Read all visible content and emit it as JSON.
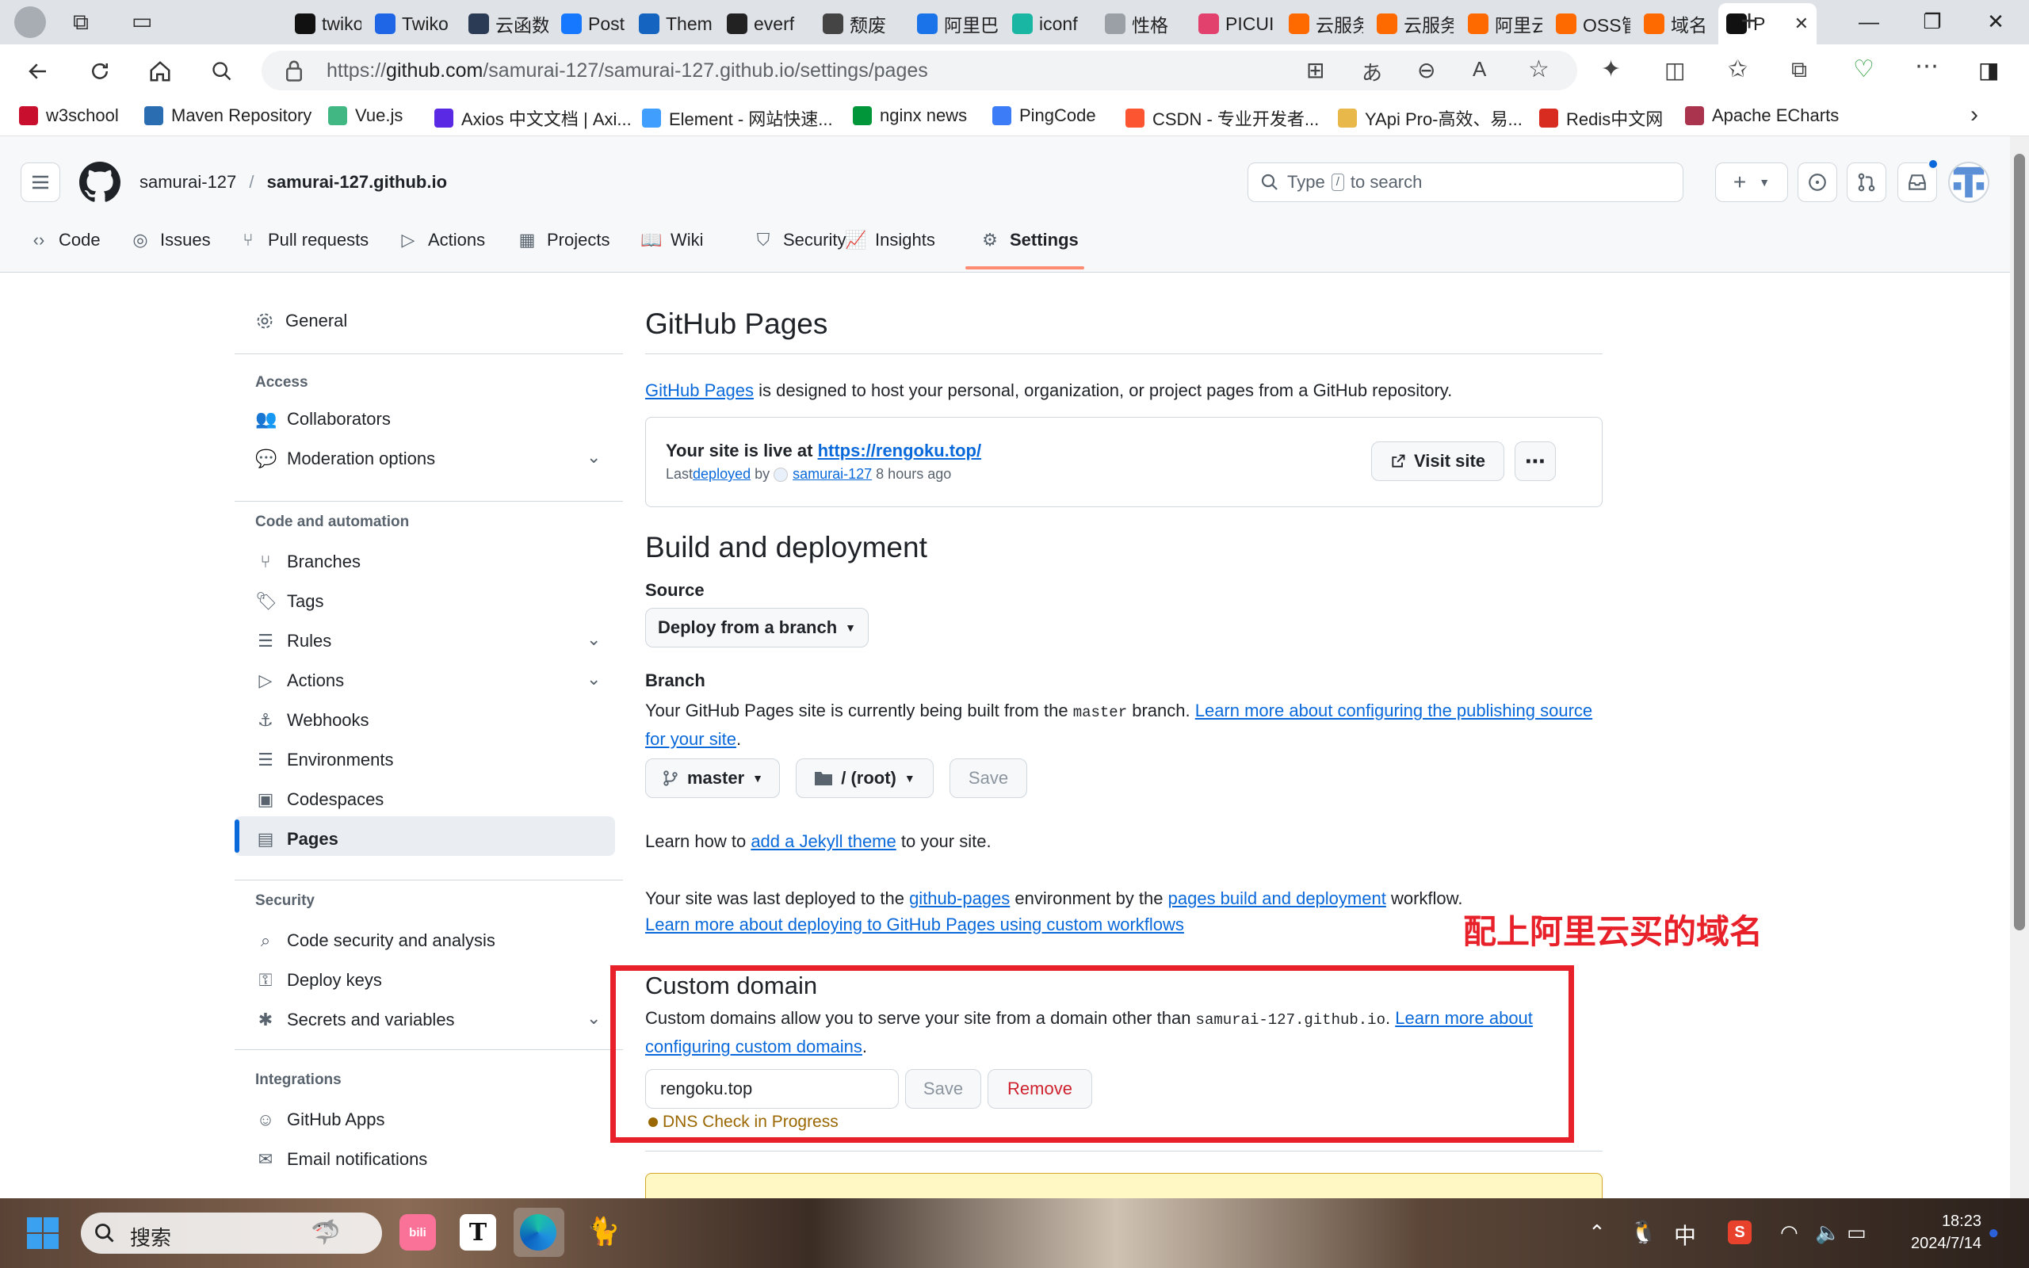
{
  "browser": {
    "tabs": [
      {
        "label": "twiko",
        "color": "#111111"
      },
      {
        "label": "Twiko",
        "color": "#1e66e6"
      },
      {
        "label": "云函数",
        "color": "#2b3a55"
      },
      {
        "label": "PostC",
        "color": "#1677ff"
      },
      {
        "label": "Them",
        "color": "#1565c0"
      },
      {
        "label": "everf",
        "color": "#222222"
      },
      {
        "label": "颓废",
        "color": "#444444"
      },
      {
        "label": "阿里巴",
        "color": "#1a73e8"
      },
      {
        "label": "iconf",
        "color": "#19b7a3"
      },
      {
        "label": "性格",
        "color": "#9aa0a6"
      },
      {
        "label": "PICUI",
        "color": "#e2416e"
      },
      {
        "label": "云服务",
        "color": "#ff6a00"
      },
      {
        "label": "云服务",
        "color": "#ff6a00"
      },
      {
        "label": "阿里云",
        "color": "#ff6a00"
      },
      {
        "label": "OSS管",
        "color": "#ff6a00"
      },
      {
        "label": "域名",
        "color": "#ff6a00"
      },
      {
        "label": "P",
        "color": "#111111"
      }
    ],
    "url_prefix": "https://",
    "url_host": "github.com",
    "url_path": "/samurai-127/samurai-127.github.io/settings/pages",
    "bookmarks": [
      {
        "label": "w3school",
        "color": "#c8102e"
      },
      {
        "label": "Maven Repository",
        "color": "#2a6db0"
      },
      {
        "label": "Vue.js",
        "color": "#41b883"
      },
      {
        "label": "Axios 中文文档 | Axi...",
        "color": "#5a29e4"
      },
      {
        "label": "Element - 网站快速...",
        "color": "#409eff"
      },
      {
        "label": "nginx news",
        "color": "#009639"
      },
      {
        "label": "PingCode",
        "color": "#3c7cf7"
      },
      {
        "label": "CSDN - 专业开发者...",
        "color": "#fc5531"
      },
      {
        "label": "YApi Pro-高效、易...",
        "color": "#e8b84a"
      },
      {
        "label": "Redis中文网",
        "color": "#d82c20"
      },
      {
        "label": "Apache ECharts",
        "color": "#aa344d"
      }
    ]
  },
  "github": {
    "owner": "samurai-127",
    "repo": "samurai-127.github.io",
    "search_placeholder_pre": "Type",
    "search_key": "/",
    "search_placeholder_post": "to search",
    "repo_tabs": [
      "Code",
      "Issues",
      "Pull requests",
      "Actions",
      "Projects",
      "Wiki",
      "Security",
      "Insights",
      "Settings"
    ],
    "active_tab": "Settings"
  },
  "sidebar": {
    "general": "General",
    "access_heading": "Access",
    "access": [
      "Collaborators",
      "Moderation options"
    ],
    "code_heading": "Code and automation",
    "code": [
      "Branches",
      "Tags",
      "Rules",
      "Actions",
      "Webhooks",
      "Environments",
      "Codespaces",
      "Pages"
    ],
    "security_heading": "Security",
    "security": [
      "Code security and analysis",
      "Deploy keys",
      "Secrets and variables"
    ],
    "integrations_heading": "Integrations",
    "integrations": [
      "GitHub Apps",
      "Email notifications"
    ]
  },
  "pages": {
    "title": "GitHub Pages",
    "intro_link": "GitHub Pages",
    "intro_rest": " is designed to host your personal, organization, or project pages from a GitHub repository.",
    "live_prefix": "Your site is live at ",
    "live_url": "https://rengoku.top/",
    "last_prefix": "Last ",
    "last_link": "deployed",
    "last_by": " by ",
    "last_user": "samurai-127",
    "last_time": " 8 hours ago",
    "visit_site": "Visit site",
    "build_title": "Build and deployment",
    "source_label": "Source",
    "source_value": "Deploy from a branch",
    "branch_label": "Branch",
    "branch_text_1": "Your GitHub Pages site is currently being built from the ",
    "branch_code": "master",
    "branch_text_2": " branch. ",
    "branch_link_1": "Learn more about configuring the publishing source",
    "branch_link_2": "for your site",
    "branch_text_3": ".",
    "branch_value": "master",
    "folder_value": "/ (root)",
    "save": "Save",
    "jekyll_pre": "Learn how to ",
    "jekyll_link": "add a Jekyll theme",
    "jekyll_post": " to your site.",
    "deployed_1": "Your site was last deployed to the ",
    "deployed_env": "github-pages",
    "deployed_2": " environment by the ",
    "deployed_wf": "pages build and deployment",
    "deployed_3": " workflow.",
    "deployed_link": "Learn more about deploying to GitHub Pages using custom workflows",
    "custom_title": "Custom domain",
    "custom_text_1": "Custom domains allow you to serve your site from a domain other than ",
    "custom_code": "samurai-127.github.io",
    "custom_text_2": ". ",
    "custom_link_1": "Learn more about",
    "custom_link_2": "configuring custom domains",
    "custom_text_3": ".",
    "domain_value": "rengoku.top",
    "remove": "Remove",
    "dns_status": "DNS Check in Progress",
    "annotation": "配上阿里云买的域名"
  },
  "taskbar": {
    "search": "搜索",
    "ime": "中",
    "time": "18:23",
    "date": "2024/7/14"
  },
  "colors": {
    "accent": "#fd8c73",
    "link": "#0969da",
    "annotation": "#e8202a",
    "dns": "#9a6700"
  }
}
